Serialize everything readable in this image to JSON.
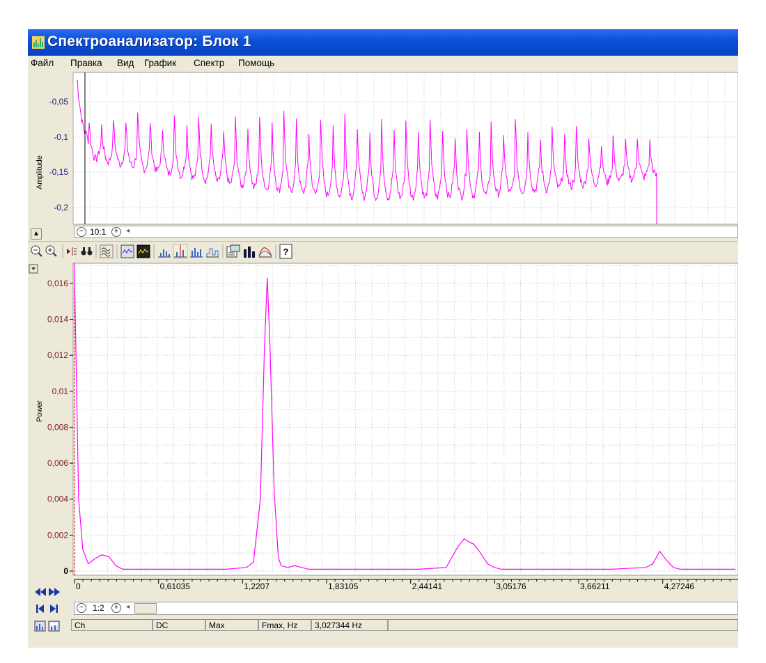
{
  "window": {
    "title": "Спектроанализатор: Блок 1"
  },
  "menu": [
    "Файл",
    "Правка",
    "Вид",
    "График",
    "Спектр",
    "Помощь"
  ],
  "top_plot": {
    "ylabel": "Amplitude",
    "ytick_labels": [
      "-0,05",
      "-0,1",
      "-0,15",
      "-0,2"
    ],
    "zoom_label": "10:1",
    "trace_color": "#ff00ff"
  },
  "toolbar": {
    "icons": [
      "zoom-out-icon",
      "zoom-in-icon",
      "cursor-icon",
      "binoculars-icon",
      "wave-icon",
      "display-mode-icon",
      "display-mode-2-icon",
      "spectrum-bars-icon",
      "spectrum-cursor-icon",
      "spectrum-multi-icon",
      "spectrum-step-icon",
      "properties-icon",
      "bar-chart-icon",
      "envelope-icon",
      "help-icon"
    ]
  },
  "bottom_plot": {
    "ylabel": "Power",
    "zoom_label": "1:2",
    "trace_color": "#ff00ff"
  },
  "chart_data": {
    "type": "line",
    "ylabel": "Power",
    "ylim": [
      0,
      0.0165
    ],
    "xlim": [
      0,
      4.8
    ],
    "yticks": [
      "0",
      "0,002",
      "0,004",
      "0,006",
      "0,008",
      "0,01",
      "0,012",
      "0,014",
      "0,016"
    ],
    "xticks": [
      "0",
      "0,61035",
      "1,2207",
      "1,83105",
      "2,44141",
      "3,05176",
      "3,66211",
      "4,27246",
      "4,8"
    ],
    "x": [
      0.0,
      0.03,
      0.06,
      0.1,
      0.15,
      0.2,
      0.25,
      0.3,
      0.35,
      0.4,
      0.5,
      0.7,
      0.9,
      1.1,
      1.25,
      1.3,
      1.35,
      1.38,
      1.4,
      1.42,
      1.45,
      1.48,
      1.5,
      1.55,
      1.6,
      1.65,
      1.7,
      1.8,
      2.0,
      2.2,
      2.5,
      2.7,
      2.78,
      2.83,
      2.87,
      2.9,
      2.95,
      3.0,
      3.05,
      3.1,
      3.3,
      3.6,
      3.9,
      4.15,
      4.2,
      4.25,
      4.3,
      4.35,
      4.4,
      4.5,
      4.7,
      4.8
    ],
    "values": [
      0.0165,
      0.004,
      0.0012,
      0.0004,
      0.0007,
      0.0009,
      0.0008,
      0.0003,
      0.0001,
      0.0001,
      0.0001,
      0.0001,
      0.0001,
      0.0001,
      0.0002,
      0.0005,
      0.004,
      0.0125,
      0.0163,
      0.0125,
      0.0045,
      0.0008,
      0.0003,
      0.0002,
      0.0003,
      0.0002,
      0.0001,
      0.0001,
      0.0001,
      0.0001,
      0.0001,
      0.0002,
      0.0013,
      0.0018,
      0.0016,
      0.0015,
      0.001,
      0.0004,
      0.0002,
      0.0001,
      0.0001,
      0.0001,
      0.0001,
      0.0002,
      0.0004,
      0.0011,
      0.0006,
      0.0002,
      0.0001,
      0.0001,
      0.0001,
      0.0001
    ],
    "grid": true,
    "color": "#ff00ff"
  },
  "status": {
    "cells": [
      "Ch",
      "DC",
      "Max",
      "Fmax, Hz",
      "3,027344 Hz"
    ]
  }
}
